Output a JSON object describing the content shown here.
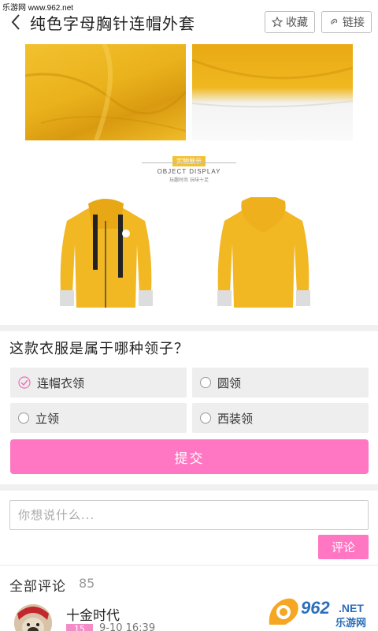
{
  "watermark_top": "乐游网 www.962.net",
  "header": {
    "title": "纯色字母胸针连帽外套",
    "favorite_label": "收藏",
    "link_label": "链接"
  },
  "display": {
    "badge": "实物展示",
    "english": "OBJECT DISPLAY",
    "sub": "玩趣时尚 玩味十足"
  },
  "quiz": {
    "question": "这款衣服是属于哪种领子？",
    "options": [
      {
        "label": "连帽衣领",
        "checked": true
      },
      {
        "label": "圆领",
        "checked": false
      },
      {
        "label": "立领",
        "checked": false
      },
      {
        "label": "西装领",
        "checked": false
      }
    ],
    "submit_label": "提交"
  },
  "comment_box": {
    "placeholder": "你想说什么...",
    "button_label": "评论"
  },
  "comments": {
    "header": "全部评论",
    "count": "85",
    "first": {
      "username": "十金时代",
      "level": "15",
      "time": "9-10 16:39"
    }
  },
  "colors": {
    "accent_pink": "#ff76c2",
    "jacket_yellow": "#f2b824"
  }
}
